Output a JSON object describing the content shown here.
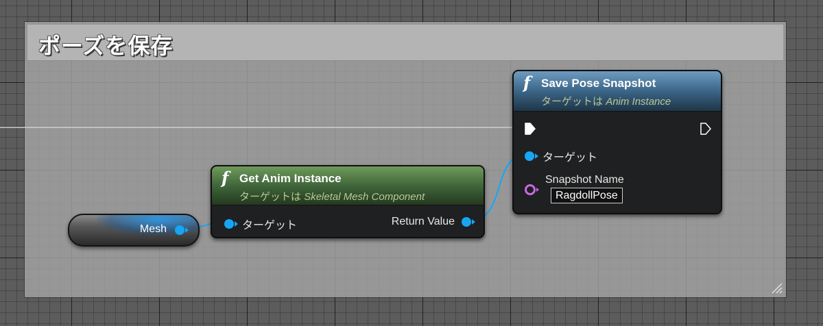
{
  "comment": {
    "title": "ポーズを保存"
  },
  "variable_node": {
    "label": "Mesh",
    "pin_type": "object"
  },
  "get_anim_instance": {
    "icon": "function-icon",
    "title": "Get Anim Instance",
    "subtitle_prefix": "ターゲットは",
    "subtitle_target": "Skeletal Mesh Component",
    "input_pin": "ターゲット",
    "output_pin": "Return Value",
    "header_color": "#40663a"
  },
  "save_pose_snapshot": {
    "icon": "function-icon",
    "title": "Save Pose Snapshot",
    "subtitle_prefix": "ターゲットは",
    "subtitle_target": "Anim Instance",
    "target_pin": "ターゲット",
    "snapshot_pin": "Snapshot Name",
    "snapshot_value": "RagdollPose",
    "header_color": "#3c6587"
  },
  "colors": {
    "object_pin": "#17a6f3",
    "string_pin": "#c76ae6",
    "exec_pin": "#ffffff",
    "wire": "#17a6f3"
  }
}
